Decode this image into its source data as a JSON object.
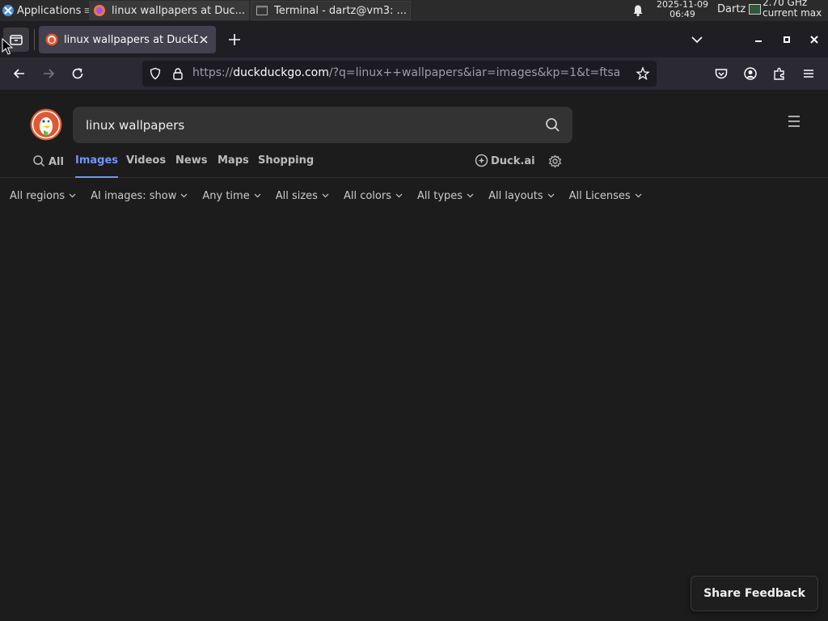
{
  "taskbar": {
    "applications_label": "Applications",
    "apps_separator": "≡",
    "tasks": [
      {
        "label": "linux wallpapers at Duc...",
        "icon": "firefox-icon"
      },
      {
        "label": "Terminal - dartz@vm3: ...",
        "icon": "terminal-icon"
      }
    ],
    "clock_date": "2025-11-09",
    "clock_time": "06:49",
    "user": "Dartz",
    "cpu_line1": "2.70 GHz",
    "cpu_line2": "current max"
  },
  "browser": {
    "tab_title": "linux wallpapers at DuckDuckGo",
    "url_prefix": "https://",
    "url_host": "duckduckgo.com",
    "url_path": "/?q=linux++wallpapers&iar=images&kp=1&t=ftsa"
  },
  "page": {
    "search_value": "linux wallpapers",
    "verticals": [
      {
        "label": "All",
        "active": false
      },
      {
        "label": "Images",
        "active": true
      },
      {
        "label": "Videos",
        "active": false
      },
      {
        "label": "News",
        "active": false
      },
      {
        "label": "Maps",
        "active": false
      },
      {
        "label": "Shopping",
        "active": false
      }
    ],
    "duck_ai_label": "Duck.ai",
    "filters": [
      "All regions",
      "AI images: show",
      "Any time",
      "All sizes",
      "All colors",
      "All types",
      "All layouts",
      "All Licenses"
    ],
    "feedback_label": "Share Feedback"
  },
  "colors": {
    "page_bg": "#1c1c1c",
    "accent": "#7295f6",
    "duck_orange": "#de5833"
  }
}
